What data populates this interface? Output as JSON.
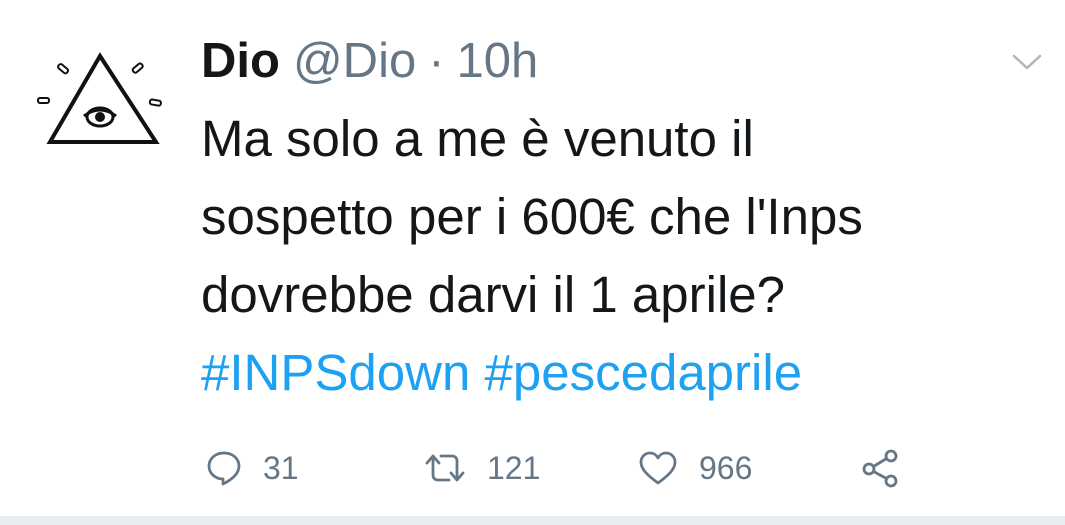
{
  "author": {
    "name": "Dio",
    "handle": "@Dio",
    "separator": "·",
    "time": "10h",
    "avatar_icon": "eye-triangle-icon"
  },
  "tweet": {
    "lines": [
      "Ma solo a me è venuto il",
      "sospetto per i 600€ che l'Inps",
      "dovrebbe darvi il 1 aprile?"
    ],
    "hashtags": [
      "#INPSdown",
      "#pescedaprile"
    ]
  },
  "actions": {
    "reply": {
      "icon": "reply-icon",
      "count": "31"
    },
    "retweet": {
      "icon": "retweet-icon",
      "count": "121"
    },
    "like": {
      "icon": "heart-icon",
      "count": "966"
    },
    "share": {
      "icon": "share-icon"
    }
  },
  "menu": {
    "icon": "chevron-down-icon"
  },
  "colors": {
    "text": "#14171a",
    "secondary": "#657786",
    "link": "#1da1f2",
    "divider": "#e6ecf0"
  }
}
